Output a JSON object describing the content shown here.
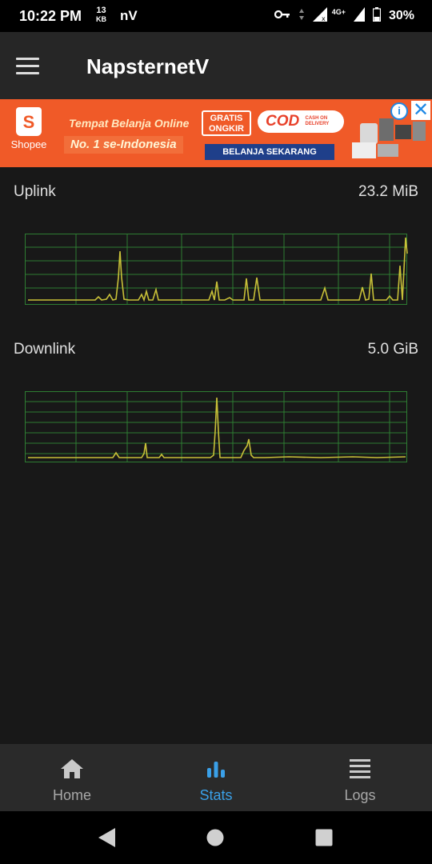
{
  "status_bar": {
    "time": "10:22 PM",
    "net_speed_value": "13",
    "net_speed_unit": "KB",
    "app_indicator": "nV",
    "network_type": "4G+",
    "battery": "30%"
  },
  "app_bar": {
    "title": "NapsternetV"
  },
  "ad": {
    "brand": "Shopee",
    "line1": "Tempat Belanja Online",
    "line2": "No. 1 se-Indonesia",
    "gratis": "GRATIS ONGKIR",
    "cod": "COD",
    "cod_small": "CASH ON DELIVERY",
    "cta": "BELANJA SEKARANG",
    "info_icon": "i",
    "close_icon": "✕"
  },
  "stats": {
    "uplink": {
      "label": "Uplink",
      "value": "23.2 MiB"
    },
    "downlink": {
      "label": "Downlink",
      "value": "5.0 GiB"
    }
  },
  "colors": {
    "accent": "#3aa0e8",
    "graph_line": "#c8c038",
    "graph_grid": "#2e7d32",
    "ad_bg": "#f05a28"
  },
  "bottom_nav": {
    "items": [
      {
        "label": "Home",
        "icon": "home-icon",
        "active": false
      },
      {
        "label": "Stats",
        "icon": "bar-chart-icon",
        "active": true
      },
      {
        "label": "Logs",
        "icon": "list-icon",
        "active": false
      }
    ]
  }
}
